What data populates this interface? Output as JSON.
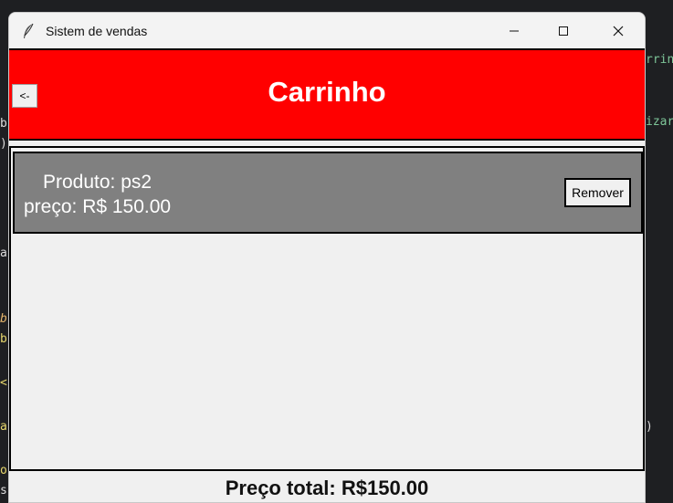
{
  "window": {
    "title": "Sistem de vendas"
  },
  "header": {
    "back_label": "<-",
    "title": "Carrinho",
    "color": "#ff0000"
  },
  "cart": {
    "items": [
      {
        "product_line": "Produto: ps2",
        "price_line": "preço: R$ 150.00",
        "remove_label": "Remover"
      }
    ]
  },
  "footer": {
    "total_label": "Preço total: R$150.00"
  },
  "background_editor": {
    "fragments": [
      "rrin",
      "izar",
      "b",
      ")",
      "a",
      "b",
      "b",
      "<",
      "a",
      ")",
      "o",
      "s"
    ]
  }
}
